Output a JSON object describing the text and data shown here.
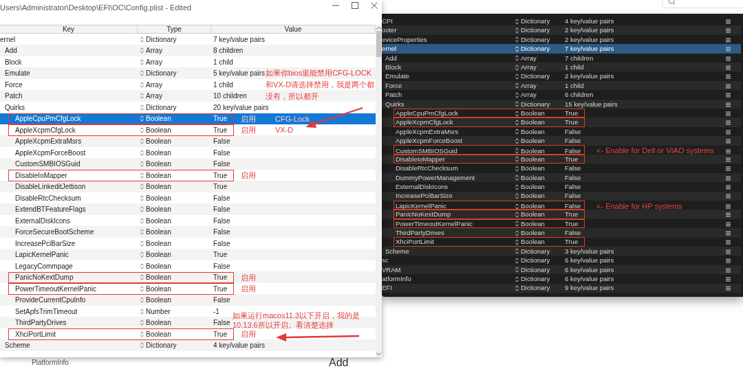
{
  "left_window": {
    "title": "Users\\Administrator\\Desktop\\EFI\\OC\\Config.plist - Edited",
    "columns": [
      "Key",
      "Type",
      "Value"
    ],
    "rows": [
      {
        "key": "ernel",
        "type": "Dictionary",
        "value": "7 key/value pairs",
        "selected": false,
        "highlighted": false,
        "children": [
          {
            "key": "Add",
            "type": "Array",
            "value": "8 children",
            "selected": false,
            "highlighted": false
          },
          {
            "key": "Block",
            "type": "Array",
            "value": "1 child",
            "selected": false,
            "highlighted": false
          },
          {
            "key": "Emulate",
            "type": "Dictionary",
            "value": "5 key/value pairs",
            "selected": false,
            "highlighted": false
          },
          {
            "key": "Force",
            "type": "Array",
            "value": "1 child",
            "selected": false,
            "highlighted": false
          },
          {
            "key": "Patch",
            "type": "Array",
            "value": "10 children",
            "selected": false,
            "highlighted": false
          },
          {
            "key": "Quirks",
            "type": "Dictionary",
            "value": "20 key/value pairs",
            "selected": false,
            "highlighted": false,
            "children": [
              {
                "key": "AppleCpuPmCfgLock",
                "type": "Boolean",
                "value": "True",
                "selected": true,
                "highlighted": true,
                "notes": [
                  "启用",
                  "CFG-Lock"
                ]
              },
              {
                "key": "AppleXcpmCfgLock",
                "type": "Boolean",
                "value": "True",
                "selected": false,
                "highlighted": true,
                "notes": [
                  "启用",
                  "VX-D"
                ]
              },
              {
                "key": "AppleXcpmExtraMsrs",
                "type": "Boolean",
                "value": "False",
                "selected": false,
                "highlighted": false
              },
              {
                "key": "AppleXcpmForceBoost",
                "type": "Boolean",
                "value": "False",
                "selected": false,
                "highlighted": false
              },
              {
                "key": "CustomSMBIOSGuid",
                "type": "Boolean",
                "value": "False",
                "selected": false,
                "highlighted": false
              },
              {
                "key": "DisableIoMapper",
                "type": "Boolean",
                "value": "True",
                "selected": false,
                "highlighted": true,
                "notes": [
                  "启用"
                ]
              },
              {
                "key": "DisableLinkeditJettison",
                "type": "Boolean",
                "value": "True",
                "selected": false,
                "highlighted": false
              },
              {
                "key": "DisableRtcChecksum",
                "type": "Boolean",
                "value": "False",
                "selected": false,
                "highlighted": false
              },
              {
                "key": "ExtendBTFeatureFlags",
                "type": "Boolean",
                "value": "False",
                "selected": false,
                "highlighted": false
              },
              {
                "key": "ExternalDiskIcons",
                "type": "Boolean",
                "value": "False",
                "selected": false,
                "highlighted": false
              },
              {
                "key": "ForceSecureBootScheme",
                "type": "Boolean",
                "value": "False",
                "selected": false,
                "highlighted": false
              },
              {
                "key": "IncreasePciBarSize",
                "type": "Boolean",
                "value": "False",
                "selected": false,
                "highlighted": false
              },
              {
                "key": "LapicKernelPanic",
                "type": "Boolean",
                "value": "True",
                "selected": false,
                "highlighted": false
              },
              {
                "key": "LegacyCommpage",
                "type": "Boolean",
                "value": "False",
                "selected": false,
                "highlighted": false
              },
              {
                "key": "PanicNoKextDump",
                "type": "Boolean",
                "value": "True",
                "selected": false,
                "highlighted": true,
                "notes": [
                  "启用"
                ]
              },
              {
                "key": "PowerTimeoutKernelPanic",
                "type": "Boolean",
                "value": "True",
                "selected": false,
                "highlighted": true,
                "notes": [
                  "启用"
                ]
              },
              {
                "key": "ProvideCurrentCpuInfo",
                "type": "Boolean",
                "value": "False",
                "selected": false,
                "highlighted": false
              },
              {
                "key": "SetApfsTrimTimeout",
                "type": "Number",
                "value": "-1",
                "selected": false,
                "highlighted": false
              },
              {
                "key": "ThirdPartyDrives",
                "type": "Boolean",
                "value": "False",
                "selected": false,
                "highlighted": false
              },
              {
                "key": "XhciPortLimit",
                "type": "Boolean",
                "value": "True",
                "selected": false,
                "highlighted": true,
                "notes": [
                  "启用"
                ]
              }
            ]
          },
          {
            "key": "Scheme",
            "type": "Dictionary",
            "value": "4 key/value pairs",
            "selected": false,
            "highlighted": false
          }
        ]
      }
    ],
    "annotations": [
      {
        "lines": [
          "如果你bios里能禁用CFG-LOCK",
          "和VX-D请选择禁用，我是两个都",
          "没有，所以都开"
        ]
      },
      {
        "lines": [
          "如果运行macos11.3以下开启，我的是",
          "10.13.6所以开启。看清楚选择"
        ]
      }
    ]
  },
  "right_window": {
    "rows": [
      {
        "key": "CPI",
        "type": "Dictionary",
        "value": "4 key/value pairs",
        "selected": false,
        "highlighted": false
      },
      {
        "key": "ooter",
        "type": "Dictionary",
        "value": "2 key/value pairs",
        "selected": false,
        "highlighted": false
      },
      {
        "key": "eviceProperties",
        "type": "Dictionary",
        "value": "2 key/value pairs",
        "selected": false,
        "highlighted": false
      },
      {
        "key": "ernel",
        "type": "Dictionary",
        "value": "7 key/value pairs",
        "selected": true,
        "highlighted": false,
        "children": [
          {
            "key": "Add",
            "type": "Array",
            "value": "7 children",
            "selected": false,
            "highlighted": false
          },
          {
            "key": "Block",
            "type": "Array",
            "value": "1 child",
            "selected": false,
            "highlighted": false
          },
          {
            "key": "Emulate",
            "type": "Dictionary",
            "value": "2 key/value pairs",
            "selected": false,
            "highlighted": false
          },
          {
            "key": "Force",
            "type": "Array",
            "value": "1 child",
            "selected": false,
            "highlighted": false
          },
          {
            "key": "Patch",
            "type": "Array",
            "value": "6 children",
            "selected": false,
            "highlighted": false
          },
          {
            "key": "Quirks",
            "type": "Dictionary",
            "value": "15 key/value pairs",
            "selected": false,
            "highlighted": false,
            "children": [
              {
                "key": "AppleCpuPmCfgLock",
                "type": "Boolean",
                "value": "True",
                "selected": false,
                "highlighted": true
              },
              {
                "key": "AppleXcpmCfgLock",
                "type": "Boolean",
                "value": "True",
                "selected": false,
                "highlighted": true
              },
              {
                "key": "AppleXcpmExtraMsrs",
                "type": "Boolean",
                "value": "False",
                "selected": false,
                "highlighted": false
              },
              {
                "key": "AppleXcpmForceBoost",
                "type": "Boolean",
                "value": "False",
                "selected": false,
                "highlighted": false
              },
              {
                "key": "CustomSMBIOSGuid",
                "type": "Boolean",
                "value": "False",
                "selected": false,
                "highlighted": true,
                "notes": [
                  "<- Enable for Dell or VIAO systems"
                ]
              },
              {
                "key": "DisableIoMapper",
                "type": "Boolean",
                "value": "True",
                "selected": false,
                "highlighted": true
              },
              {
                "key": "DisableRtcChecksum",
                "type": "Boolean",
                "value": "False",
                "selected": false,
                "highlighted": false
              },
              {
                "key": "DummyPowerManagement",
                "type": "Boolean",
                "value": "False",
                "selected": false,
                "highlighted": false
              },
              {
                "key": "ExternalDiskIcons",
                "type": "Boolean",
                "value": "False",
                "selected": false,
                "highlighted": false
              },
              {
                "key": "IncreasePciBarSize",
                "type": "Boolean",
                "value": "False",
                "selected": false,
                "highlighted": false
              },
              {
                "key": "LapicKernelPanic",
                "type": "Boolean",
                "value": "False",
                "selected": false,
                "highlighted": true,
                "notes": [
                  "<- Enable for HP systems"
                ]
              },
              {
                "key": "PanicNoKextDump",
                "type": "Boolean",
                "value": "True",
                "selected": false,
                "highlighted": true
              },
              {
                "key": "PowerTimeoutKernelPanic",
                "type": "Boolean",
                "value": "True",
                "selected": false,
                "highlighted": true
              },
              {
                "key": "ThirdPartyDrives",
                "type": "Boolean",
                "value": "False",
                "selected": false,
                "highlighted": false
              },
              {
                "key": "XhciPortLimit",
                "type": "Boolean",
                "value": "True",
                "selected": false,
                "highlighted": true
              }
            ]
          },
          {
            "key": "Scheme",
            "type": "Dictionary",
            "value": "3 key/value pairs",
            "selected": false,
            "highlighted": false
          }
        ]
      },
      {
        "key": "sc",
        "type": "Dictionary",
        "value": "6 key/value pairs",
        "selected": false,
        "highlighted": false
      },
      {
        "key": "VRAM",
        "type": "Dictionary",
        "value": "6 key/value pairs",
        "selected": false,
        "highlighted": false
      },
      {
        "key": "atformInfo",
        "type": "Dictionary",
        "value": "6 key/value pairs",
        "selected": false,
        "highlighted": false
      },
      {
        "key": "EFI",
        "type": "Dictionary",
        "value": "9 key/value pairs",
        "selected": false,
        "highlighted": false
      }
    ]
  },
  "background": {
    "sidebar_item": "PlatformInfo",
    "heading": "Add"
  }
}
